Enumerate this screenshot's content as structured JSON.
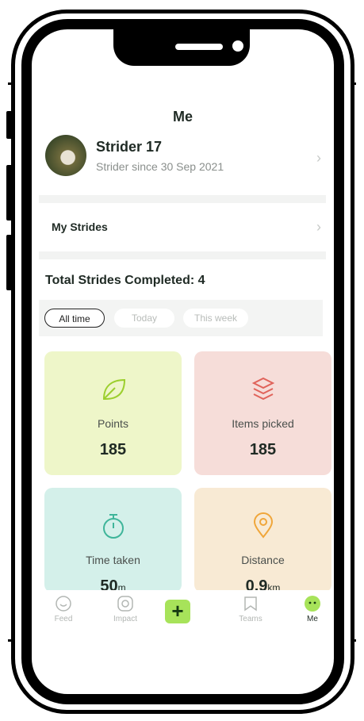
{
  "header": {
    "title": "Me"
  },
  "profile": {
    "name": "Strider 17",
    "since": "Strider since 30 Sep 2021",
    "chevron": "›"
  },
  "menu": {
    "my_strides": "My Strides",
    "chevron": "›"
  },
  "summary": {
    "total_label": "Total Strides Completed: 4"
  },
  "filters": {
    "options": [
      "All time",
      "Today",
      "This week"
    ],
    "selected": "All time"
  },
  "stats": [
    {
      "label": "Points",
      "value": "185",
      "unit": "",
      "icon": "leaf-icon",
      "bg": "#eef6c9",
      "accent": "#9ccf2e"
    },
    {
      "label": "Items picked",
      "value": "185",
      "unit": "",
      "icon": "layers-icon",
      "bg": "#f6ddd9",
      "accent": "#e0635a"
    },
    {
      "label": "Time taken",
      "value": "50",
      "unit": "m",
      "icon": "stopwatch-icon",
      "bg": "#d4f0ea",
      "accent": "#3fb59a"
    },
    {
      "label": "Distance",
      "value": "0.9",
      "unit": "km",
      "icon": "location-pin-icon",
      "bg": "#f8ead4",
      "accent": "#f0a63a"
    }
  ],
  "tabbar": {
    "items": [
      {
        "label": "Feed",
        "icon": "smile-icon"
      },
      {
        "label": "Impact",
        "icon": "target-icon"
      },
      {
        "label": "",
        "icon": "plus-icon"
      },
      {
        "label": "Teams",
        "icon": "flag-icon"
      },
      {
        "label": "Me",
        "icon": "face-icon"
      }
    ],
    "active": "Me",
    "plus_symbol": "+"
  },
  "colors": {
    "accent_green": "#a7e35a",
    "divider": "#f2f3f2"
  }
}
